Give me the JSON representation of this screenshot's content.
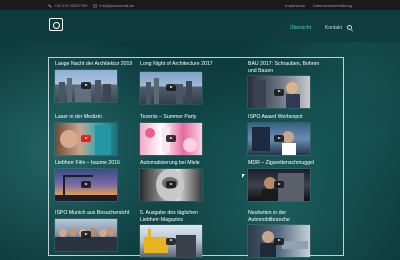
{
  "topbar": {
    "phone": "+49 176 22837769",
    "email": "info@panoramik.de",
    "impressum": "Impressum",
    "datenschutz": "Datenschutzerklärung"
  },
  "nav": {
    "items": [
      {
        "label": "Übersicht",
        "active": true
      },
      {
        "label": "Kontakt",
        "active": false
      }
    ]
  },
  "videos": [
    {
      "title": "Lange Nacht der Architektur 2019",
      "play": "dark"
    },
    {
      "title": "Long Night of Architecture 2017",
      "play": "dark"
    },
    {
      "title": "BAU 2017: Schrauben, Bohren und Bauen",
      "play": "dark"
    },
    {
      "title": "Laser in der Medizin",
      "play": "red"
    },
    {
      "title": "Tezenis – Summer Party",
      "play": "dark"
    },
    {
      "title": "ISPO Award Werbespot",
      "play": "dark"
    },
    {
      "title": "Liebherr Film – baume 2016",
      "play": "dark"
    },
    {
      "title": "Automatisierung bei Miele",
      "play": "dark"
    },
    {
      "title": "MDR – Zigarettenschmuggel",
      "play": "dark"
    },
    {
      "title": "ISPO Munich aus Besuchersicht",
      "play": "dark"
    },
    {
      "title": "5. Ausgabe des täglichen Liebherr-Magazins",
      "play": "dark"
    },
    {
      "title": "Neuheiten in der Automobilbranche",
      "play": "dark"
    }
  ],
  "colors": {
    "accent": "#3fd3c8",
    "background": "#0d3b3d",
    "youtube_red": "#e62117"
  }
}
